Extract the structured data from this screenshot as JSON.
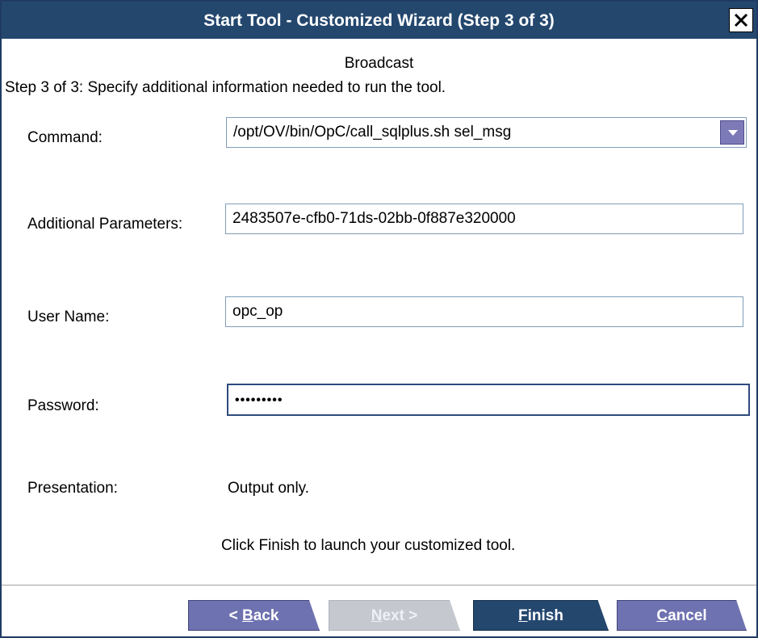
{
  "window": {
    "title": "Start Tool - Customized Wizard (Step 3 of 3)"
  },
  "header": {
    "subtitle": "Broadcast",
    "instruction": "Step 3 of 3: Specify additional information needed to run the tool."
  },
  "form": {
    "command": {
      "label": "Command:",
      "value": "/opt/OV/bin/OpC/call_sqlplus.sh sel_msg"
    },
    "parameters": {
      "label": "Additional Parameters:",
      "value": "2483507e-cfb0-71ds-02bb-0f887e320000"
    },
    "user": {
      "label": "User Name:",
      "value": "opc_op"
    },
    "password": {
      "label": "Password:",
      "value": "•••••••••"
    },
    "presentation": {
      "label": "Presentation:",
      "value": "Output only."
    }
  },
  "footer": {
    "message": "Click Finish to launch your customized tool."
  },
  "buttons": {
    "back": {
      "prefix": "< ",
      "mnemonic": "B",
      "rest": "ack"
    },
    "next": {
      "mnemonic": "N",
      "rest": "ext >"
    },
    "finish": {
      "mnemonic": "F",
      "rest": "inish"
    },
    "cancel": {
      "mnemonic": "C",
      "rest": "ancel"
    }
  }
}
